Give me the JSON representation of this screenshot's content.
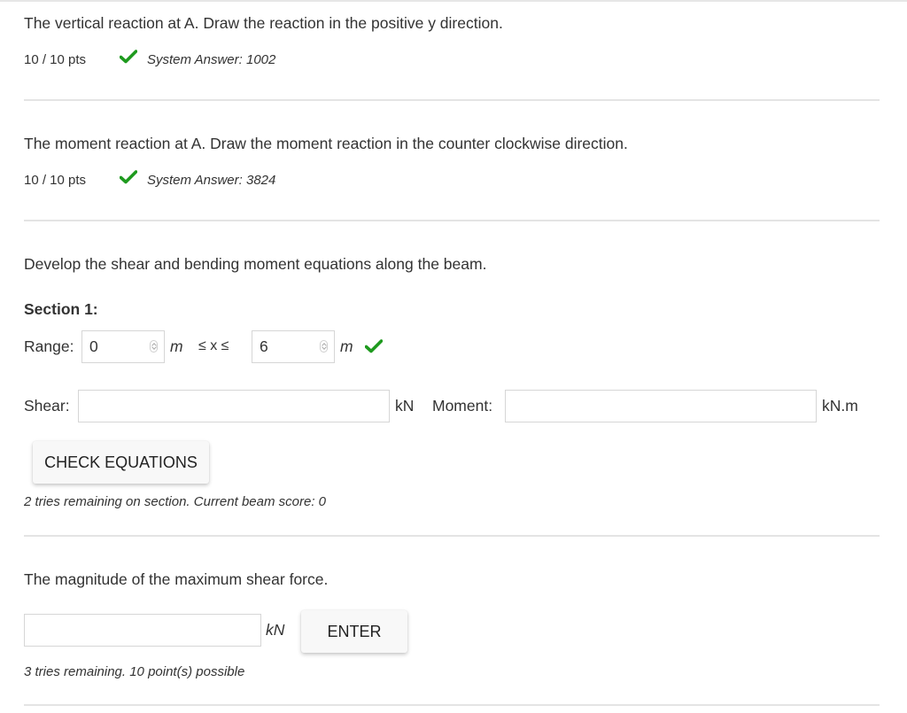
{
  "questions": [
    {
      "prompt": "The vertical reaction at A. Draw the reaction in the positive y direction.",
      "score": "10 / 10 pts",
      "status_icon": "check-icon",
      "system_answer": "System Answer: 1002"
    },
    {
      "prompt": "The moment reaction at A. Draw the moment reaction in the counter clockwise direction.",
      "score": "10 / 10 pts",
      "status_icon": "check-icon",
      "system_answer": "System Answer: 3824"
    }
  ],
  "equations": {
    "prompt": "Develop the shear and bending moment equations along the beam.",
    "section_title": "Section 1:",
    "range_label": "Range:",
    "range_start": "0",
    "range_start_unit": "m",
    "range_operator": "≤ x ≤",
    "range_end": "6",
    "range_end_unit": "m",
    "range_status_icon": "check-icon",
    "shear_label": "Shear:",
    "shear_value": "",
    "shear_unit": "kN",
    "moment_label": "Moment:",
    "moment_value": "",
    "moment_unit": "kN.m",
    "check_button": "CHECK EQUATIONS",
    "tries_note": "2 tries remaining on section. Current beam score: 0"
  },
  "max_shear": {
    "prompt": "The magnitude of the maximum shear force.",
    "value": "",
    "unit": "kN",
    "enter_button": "ENTER",
    "tries_note": "3 tries remaining. 10 point(s) possible"
  },
  "colors": {
    "check_green": "#1e9a1e",
    "text": "#333333",
    "divider": "#e4e4e4"
  }
}
